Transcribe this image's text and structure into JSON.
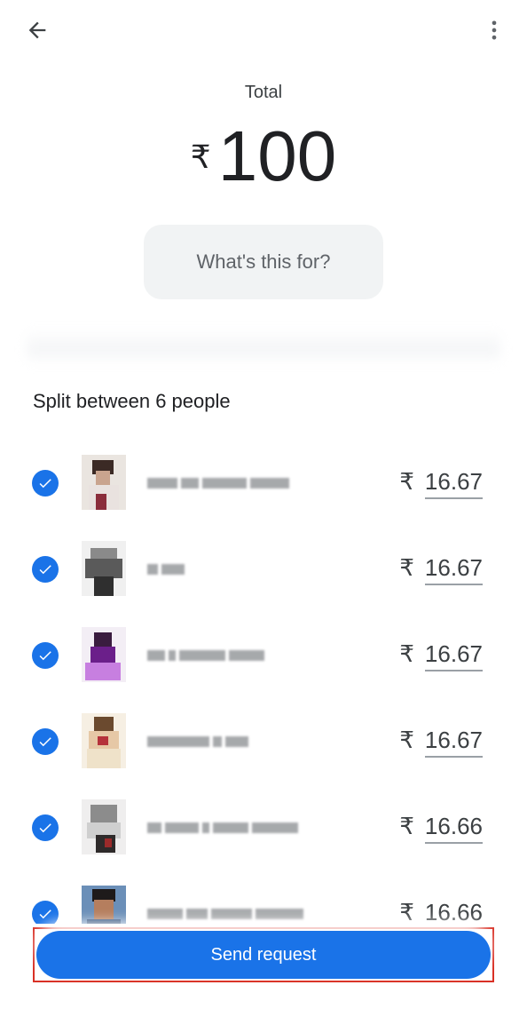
{
  "header": {
    "back_icon": "arrow-left-icon",
    "more_icon": "more-vert-icon"
  },
  "total": {
    "label": "Total",
    "currency": "₹",
    "amount": "100"
  },
  "note": {
    "placeholder": "What's this for?"
  },
  "split": {
    "title": "Split between 6 people",
    "people": [
      {
        "checked": true,
        "currency": "₹",
        "share": "16.67"
      },
      {
        "checked": true,
        "currency": "₹",
        "share": "16.67"
      },
      {
        "checked": true,
        "currency": "₹",
        "share": "16.67"
      },
      {
        "checked": true,
        "currency": "₹",
        "share": "16.67"
      },
      {
        "checked": true,
        "currency": "₹",
        "share": "16.66"
      },
      {
        "checked": true,
        "currency": "₹",
        "share": "16.66"
      }
    ]
  },
  "action": {
    "send_label": "Send request"
  },
  "colors": {
    "primary": "#1a73e8",
    "highlight": "#d93025",
    "pill_bg": "#f1f3f4"
  }
}
